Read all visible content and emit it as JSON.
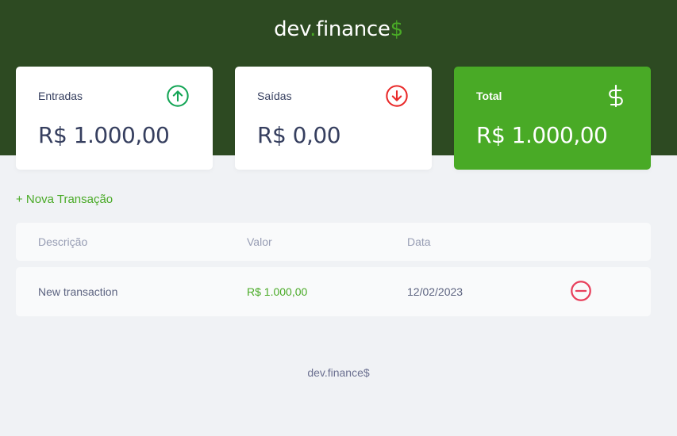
{
  "header": {
    "logo_prefix": "dev",
    "logo_dot": ".",
    "logo_main": "finance",
    "logo_suffix": "$"
  },
  "colors": {
    "header_bg": "#2d4a22",
    "accent": "#49aa26",
    "income": "#12a454",
    "expense": "#e92929"
  },
  "cards": {
    "income": {
      "label": "Entradas",
      "value": "R$ 1.000,00",
      "icon": "arrow-up-circle-icon"
    },
    "expense": {
      "label": "Saídas",
      "value": "R$ 0,00",
      "icon": "arrow-down-circle-icon"
    },
    "total": {
      "label": "Total",
      "value": "R$ 1.000,00",
      "icon": "dollar-sign-icon"
    }
  },
  "actions": {
    "new_transaction": "+ Nova Transação"
  },
  "table": {
    "headers": {
      "description": "Descrição",
      "value": "Valor",
      "date": "Data"
    },
    "rows": [
      {
        "description": "New transaction",
        "value": "R$ 1.000,00",
        "date": "12/02/2023",
        "action_icon": "minus-circle-icon"
      }
    ]
  },
  "footer": {
    "text": "dev.finance$"
  }
}
